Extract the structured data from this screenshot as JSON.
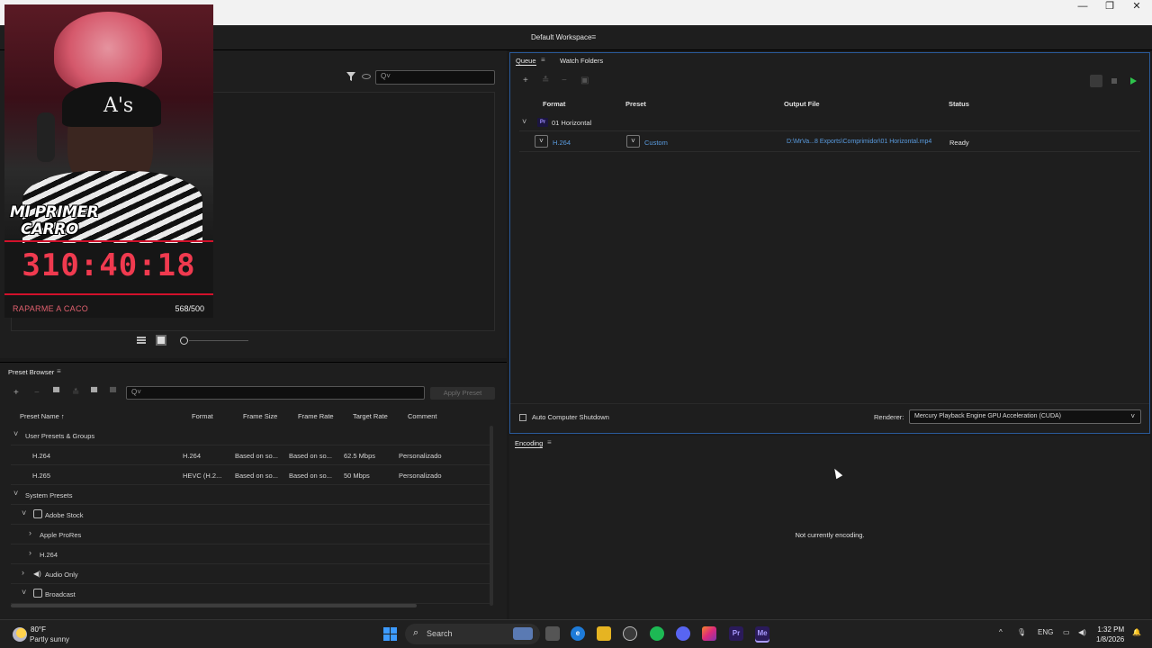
{
  "window": {
    "minimize": "—",
    "maximize": "❐",
    "close": "✕",
    "workspace_label": "Default Workspace",
    "workspace_menu": "≡"
  },
  "overlay": {
    "title_line1": "MI PRIMER",
    "title_line2": "CARRO",
    "timer": "310:40:18",
    "footer_left": "RAPARME A CACO",
    "footer_right": "568/500",
    "cap_logo": "A's"
  },
  "media_browser": {
    "search_glyph": "Q˅"
  },
  "preset_browser": {
    "title": "Preset Browser",
    "menu": "≡",
    "search_glyph": "Q˅",
    "apply_label": "Apply Preset",
    "columns": [
      "Preset Name ↑",
      "Format",
      "Frame Size",
      "Frame Rate",
      "Target Rate",
      "Comment"
    ],
    "rows": [
      {
        "expander": "˅",
        "name": "User Presets & Groups",
        "format": "",
        "frame_size": "",
        "frame_rate": "",
        "target_rate": "",
        "comment": ""
      },
      {
        "expander": "",
        "name": "H.264",
        "format": "H.264",
        "frame_size": "Based on so...",
        "frame_rate": "Based on so...",
        "target_rate": "62.5 Mbps",
        "comment": "Personalizado"
      },
      {
        "expander": "",
        "name": "H.265",
        "format": "HEVC (H.2...",
        "frame_size": "Based on so...",
        "frame_rate": "Based on so...",
        "target_rate": "50 Mbps",
        "comment": "Personalizado"
      },
      {
        "expander": "˅",
        "name": "System Presets",
        "format": "",
        "frame_size": "",
        "frame_rate": "",
        "target_rate": "",
        "comment": ""
      },
      {
        "expander": "˅",
        "name": "Adobe Stock",
        "format": "",
        "frame_size": "",
        "frame_rate": "",
        "target_rate": "",
        "comment": ""
      },
      {
        "expander": "›",
        "name": "Apple ProRes",
        "format": "",
        "frame_size": "",
        "frame_rate": "",
        "target_rate": "",
        "comment": ""
      },
      {
        "expander": "›",
        "name": "H.264",
        "format": "",
        "frame_size": "",
        "frame_rate": "",
        "target_rate": "",
        "comment": ""
      },
      {
        "expander": "›",
        "name": "Audio Only",
        "format": "",
        "frame_size": "",
        "frame_rate": "",
        "target_rate": "",
        "comment": ""
      },
      {
        "expander": "˅",
        "name": "Broadcast",
        "format": "",
        "frame_size": "",
        "frame_rate": "",
        "target_rate": "",
        "comment": ""
      }
    ]
  },
  "queue": {
    "tab_queue": "Queue",
    "tab_queue_menu": "≡",
    "tab_watch": "Watch Folders",
    "add": "+",
    "remove": "−",
    "columns": {
      "format": "Format",
      "preset": "Preset",
      "output": "Output File",
      "status": "Status"
    },
    "group": {
      "expander": "˅",
      "badge": "Pr",
      "name": "01 Horizontal"
    },
    "item": {
      "format": "H.264",
      "preset": "Custom",
      "output": "D:\\MrVa...8 Exports\\Comprimidor\\01 Horizontal.mp4",
      "status": "Ready",
      "dd": "˅"
    },
    "auto_shutdown": "Auto Computer Shutdown",
    "renderer_label": "Renderer:",
    "renderer_value": "Mercury Playback Engine GPU Acceleration (CUDA)",
    "renderer_chevron": "˅"
  },
  "encoding": {
    "title": "Encoding",
    "menu": "≡",
    "message": "Not currently encoding."
  },
  "taskbar": {
    "temp": "80°F",
    "weather": "Partly sunny",
    "search_glyph": "⌕",
    "search": "Search",
    "tray_up": "^",
    "mic": "🎙",
    "lang": "ENG",
    "time": "1:32 PM",
    "date": "1/8/2026",
    "app_labels": [
      "",
      "",
      "e",
      "",
      "",
      "",
      "",
      "",
      "Pr",
      "Me"
    ]
  },
  "colors": {
    "accent": "#2a5a9a",
    "link": "#5a9ce0",
    "play": "#2ec44c",
    "timer": "#f03a4f"
  }
}
